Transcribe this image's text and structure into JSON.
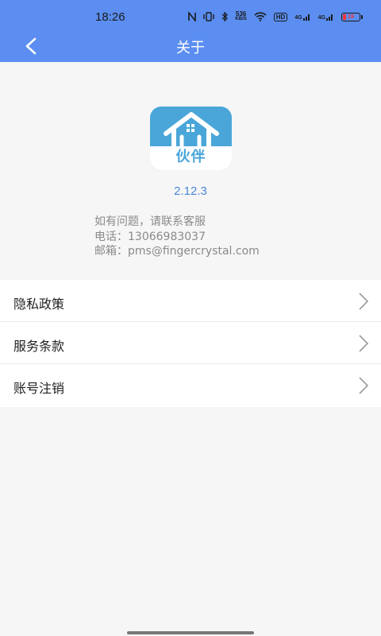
{
  "status_bar": {
    "time": "18:26",
    "speed_top": "536",
    "speed_bottom": "KB/S",
    "hd_label": "HD",
    "net1": "4G",
    "net2": "4G",
    "battery_level": "19"
  },
  "header": {
    "title": "关于"
  },
  "app": {
    "logo_text": "伙伴",
    "version": "2.12.3"
  },
  "contact": {
    "line1": "如有问题，请联系客服",
    "line2": "电话：13066983037",
    "line3": "邮箱：pms@fingercrystal.com"
  },
  "menu": {
    "items": [
      {
        "label": "隐私政策"
      },
      {
        "label": "服务条款"
      },
      {
        "label": "账号注销"
      }
    ]
  },
  "colors": {
    "header": "#5b8ef0",
    "logo": "#4aa6d9",
    "version": "#4a86d8"
  }
}
